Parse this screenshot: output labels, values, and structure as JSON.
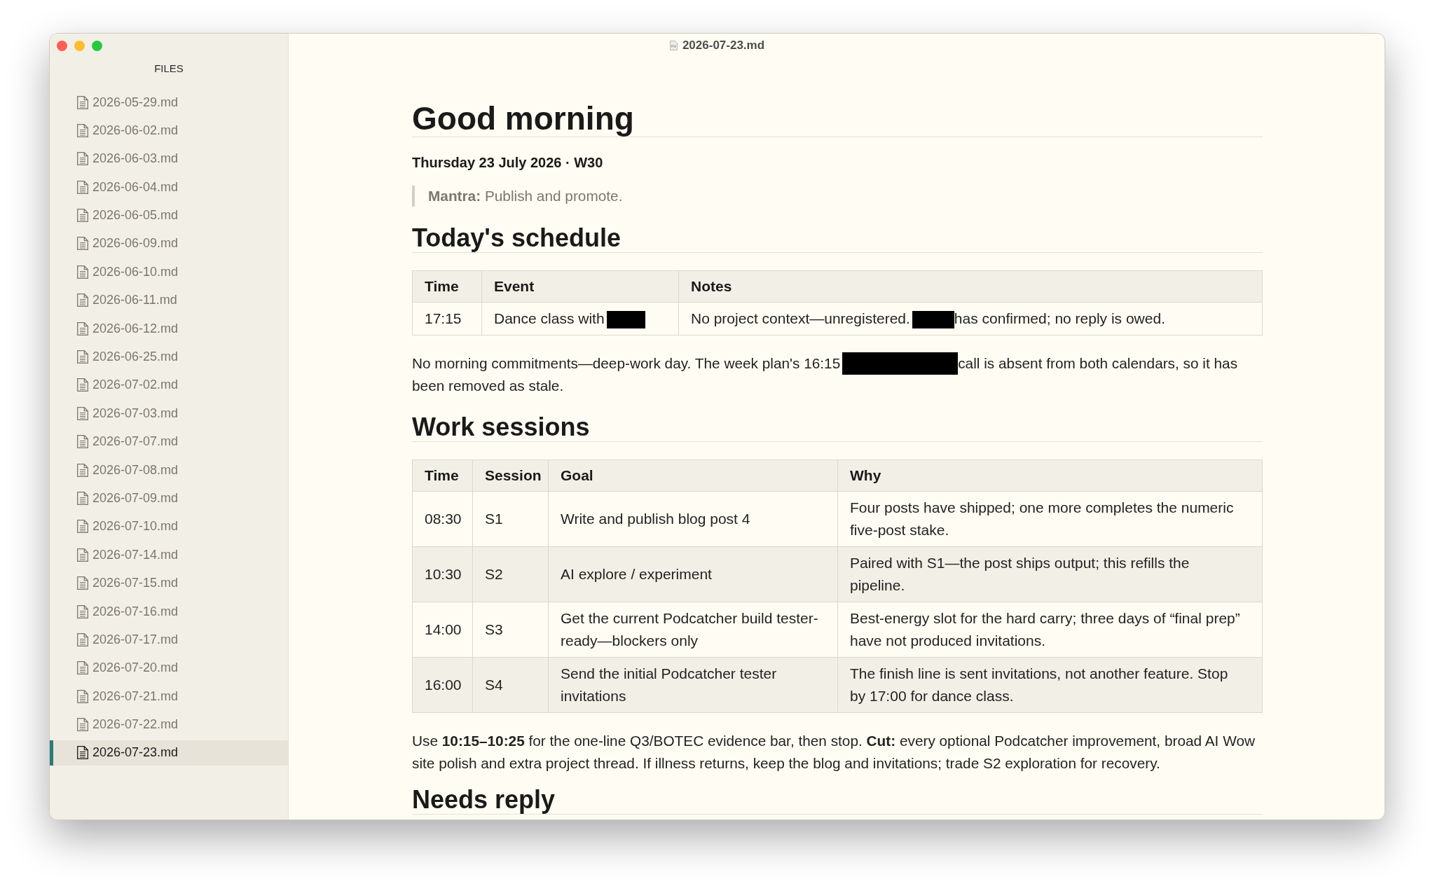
{
  "window": {
    "title": "2026-07-23.md"
  },
  "sidebar": {
    "heading": "FILES",
    "items": [
      {
        "label": "2026-05-29.md",
        "selected": false
      },
      {
        "label": "2026-06-02.md",
        "selected": false
      },
      {
        "label": "2026-06-03.md",
        "selected": false
      },
      {
        "label": "2026-06-04.md",
        "selected": false
      },
      {
        "label": "2026-06-05.md",
        "selected": false
      },
      {
        "label": "2026-06-09.md",
        "selected": false
      },
      {
        "label": "2026-06-10.md",
        "selected": false
      },
      {
        "label": "2026-06-11.md",
        "selected": false
      },
      {
        "label": "2026-06-12.md",
        "selected": false
      },
      {
        "label": "2026-06-25.md",
        "selected": false
      },
      {
        "label": "2026-07-02.md",
        "selected": false
      },
      {
        "label": "2026-07-03.md",
        "selected": false
      },
      {
        "label": "2026-07-07.md",
        "selected": false
      },
      {
        "label": "2026-07-08.md",
        "selected": false
      },
      {
        "label": "2026-07-09.md",
        "selected": false
      },
      {
        "label": "2026-07-10.md",
        "selected": false
      },
      {
        "label": "2026-07-14.md",
        "selected": false
      },
      {
        "label": "2026-07-15.md",
        "selected": false
      },
      {
        "label": "2026-07-16.md",
        "selected": false
      },
      {
        "label": "2026-07-17.md",
        "selected": false
      },
      {
        "label": "2026-07-20.md",
        "selected": false
      },
      {
        "label": "2026-07-21.md",
        "selected": false
      },
      {
        "label": "2026-07-22.md",
        "selected": false
      },
      {
        "label": "2026-07-23.md",
        "selected": true
      }
    ]
  },
  "document": {
    "blocks": [
      {
        "kind": "h1",
        "text": "Good morning"
      },
      {
        "kind": "subtitle",
        "text": "Thursday 23 July 2026 · W30"
      },
      {
        "kind": "quote",
        "text": "**Mantra:** Publish and promote."
      },
      {
        "kind": "h2",
        "text": "Today's schedule"
      },
      {
        "kind": "table",
        "columns": [
          "Time",
          "Event",
          "Notes"
        ],
        "rows": [
          [
            "17:15",
            [
              {
                "kind": "text",
                "text": "Dance class with"
              },
              {
                "kind": "redacted"
              }
            ],
            [
              {
                "kind": "text",
                "text": "No project context—unregistered."
              },
              {
                "kind": "redacted"
              },
              {
                "kind": "text",
                "text": "has confirmed; no reply is owed."
              }
            ]
          ]
        ]
      },
      {
        "kind": "paragraph",
        "segments": [
          {
            "kind": "text",
            "text": "No morning commitments—deep-work day. The week plan's 16:15"
          },
          {
            "kind": "redacted"
          },
          {
            "kind": "text",
            "text": "call is absent from both calendars, so it has been removed as stale."
          }
        ]
      },
      {
        "kind": "h2",
        "text": "Work sessions"
      },
      {
        "kind": "table",
        "columns": [
          "Time",
          "Session",
          "Goal",
          "Why"
        ],
        "rows": [
          [
            "08:30",
            "S1",
            "Write and publish blog post 4",
            "Four posts have shipped; one more completes the numeric five-post stake."
          ],
          [
            "10:30",
            "S2",
            "AI explore / experiment",
            "Paired with S1—the post ships output; this refills the pipeline."
          ],
          [
            "14:00",
            "S3",
            "Get the current Podcatcher build tester-ready—blockers only",
            "Best-energy slot for the hard carry; three days of “final prep” have not produced invitations."
          ],
          [
            "16:00",
            "S4",
            "Send the initial Podcatcher tester invitations",
            "The finish line is sent invitations, not another feature. Stop by 17:00 for dance class."
          ]
        ]
      },
      {
        "kind": "paragraph",
        "segments": [
          {
            "kind": "text",
            "text": "Use **10:15–10:25** for the one-line Q3/BOTEC evidence bar, then stop. **Cut:** every optional Podcatcher improvement, broad AI Wow site polish and extra project thread. If illness returns, keep the blog and invitations; trade S2 exploration for recovery."
          }
        ]
      },
      {
        "kind": "h2",
        "text": "Needs reply"
      }
    ]
  }
}
